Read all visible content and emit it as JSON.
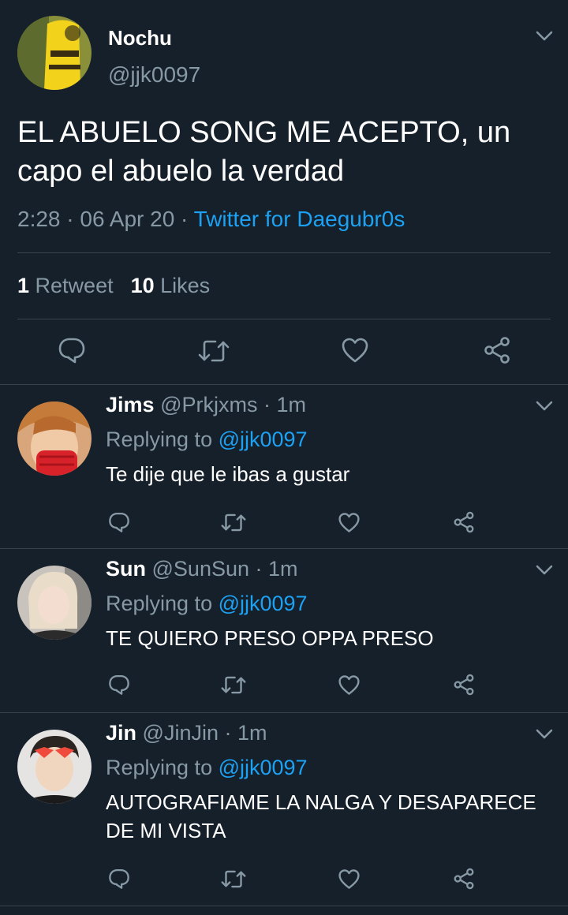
{
  "main_tweet": {
    "name": "Nochu",
    "handle": "@jjk0097",
    "text": "EL ABUELO SONG ME ACEPTO, un capo el abuelo la verdad",
    "time": "2:28",
    "separator": " · ",
    "date": "06 Apr 20",
    "source": "Twitter for Daegubr0s",
    "retweet_count": "1",
    "retweet_label": " Retweet",
    "likes_count": "10",
    "likes_label": " Likes",
    "icons": [
      "reply-icon",
      "retweet-icon",
      "like-icon",
      "share-icon",
      "chevron-down-icon"
    ]
  },
  "replies": [
    {
      "name": "Jims",
      "handle": "@Prkjxms",
      "dot": " · ",
      "time": "1m",
      "replying_label": "Replying to ",
      "replying_to": "@jjk0097",
      "text": "Te dije que le ibas a gustar"
    },
    {
      "name": "Sun",
      "handle": "@SunSun",
      "dot": " · ",
      "time": "1m",
      "replying_label": "Replying to ",
      "replying_to": "@jjk0097",
      "text": "TE QUIERO PRESO OPPA PRESO"
    },
    {
      "name": "Jin",
      "handle": "@JinJin",
      "dot": " · ",
      "time": "1m",
      "replying_label": "Replying to ",
      "replying_to": "@jjk0097",
      "text": "AUTOGRAFIAME LA NALGA Y DESAPARECE DE MI VISTA"
    }
  ],
  "colors": {
    "background": "#15202b",
    "secondary_text": "#8899a6",
    "accent": "#1da1f2",
    "divider": "#38444d"
  }
}
